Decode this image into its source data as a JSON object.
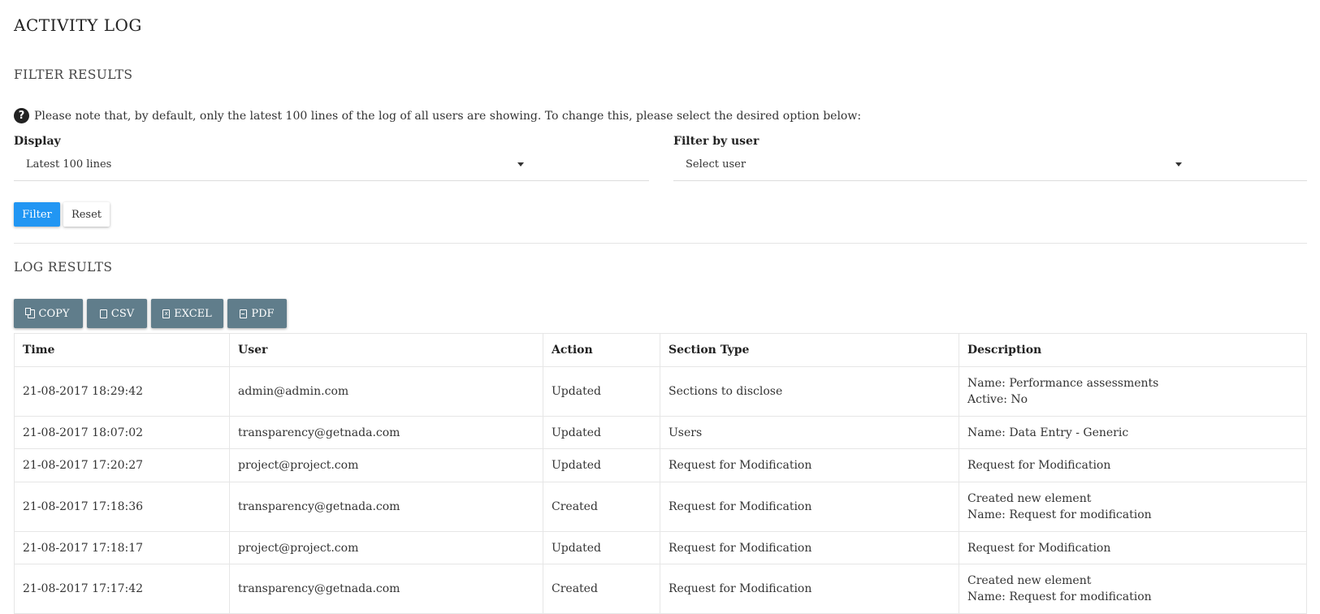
{
  "page_title": "ACTIVITY LOG",
  "filter": {
    "title": "FILTER RESULTS",
    "note": "Please note that, by default, only the latest 100 lines of the log of all users are showing. To change this, please select the desired option below:",
    "display_label": "Display",
    "display_value": "Latest 100 lines",
    "user_label": "Filter by user",
    "user_value": "Select user",
    "filter_button": "Filter",
    "reset_button": "Reset"
  },
  "log": {
    "title": "LOG RESULTS",
    "exports": {
      "copy": "COPY",
      "csv": "CSV",
      "excel": "EXCEL",
      "pdf": "PDF"
    },
    "columns": [
      "Time",
      "User",
      "Action",
      "Section Type",
      "Description"
    ],
    "rows": [
      {
        "time": "21-08-2017 18:29:42",
        "user": "admin@admin.com",
        "action": "Updated",
        "section": "Sections to disclose",
        "desc": [
          "Name: Performance assessments",
          "Active: No"
        ]
      },
      {
        "time": "21-08-2017 18:07:02",
        "user": "transparency@getnada.com",
        "action": "Updated",
        "section": "Users",
        "desc": [
          "Name: Data Entry - Generic"
        ]
      },
      {
        "time": "21-08-2017 17:20:27",
        "user": "project@project.com",
        "action": "Updated",
        "section": "Request for Modification",
        "desc": [
          "Request for Modification"
        ]
      },
      {
        "time": "21-08-2017 17:18:36",
        "user": "transparency@getnada.com",
        "action": "Created",
        "section": "Request for Modification",
        "desc": [
          "Created new element",
          "Name: Request for modification"
        ]
      },
      {
        "time": "21-08-2017 17:18:17",
        "user": "project@project.com",
        "action": "Updated",
        "section": "Request for Modification",
        "desc": [
          "Request for Modification"
        ]
      },
      {
        "time": "21-08-2017 17:17:42",
        "user": "transparency@getnada.com",
        "action": "Created",
        "section": "Request for Modification",
        "desc": [
          "Created new element",
          "Name: Request for modification"
        ]
      }
    ]
  },
  "colors": {
    "primary": "#2196f3",
    "export": "#607d8b"
  }
}
